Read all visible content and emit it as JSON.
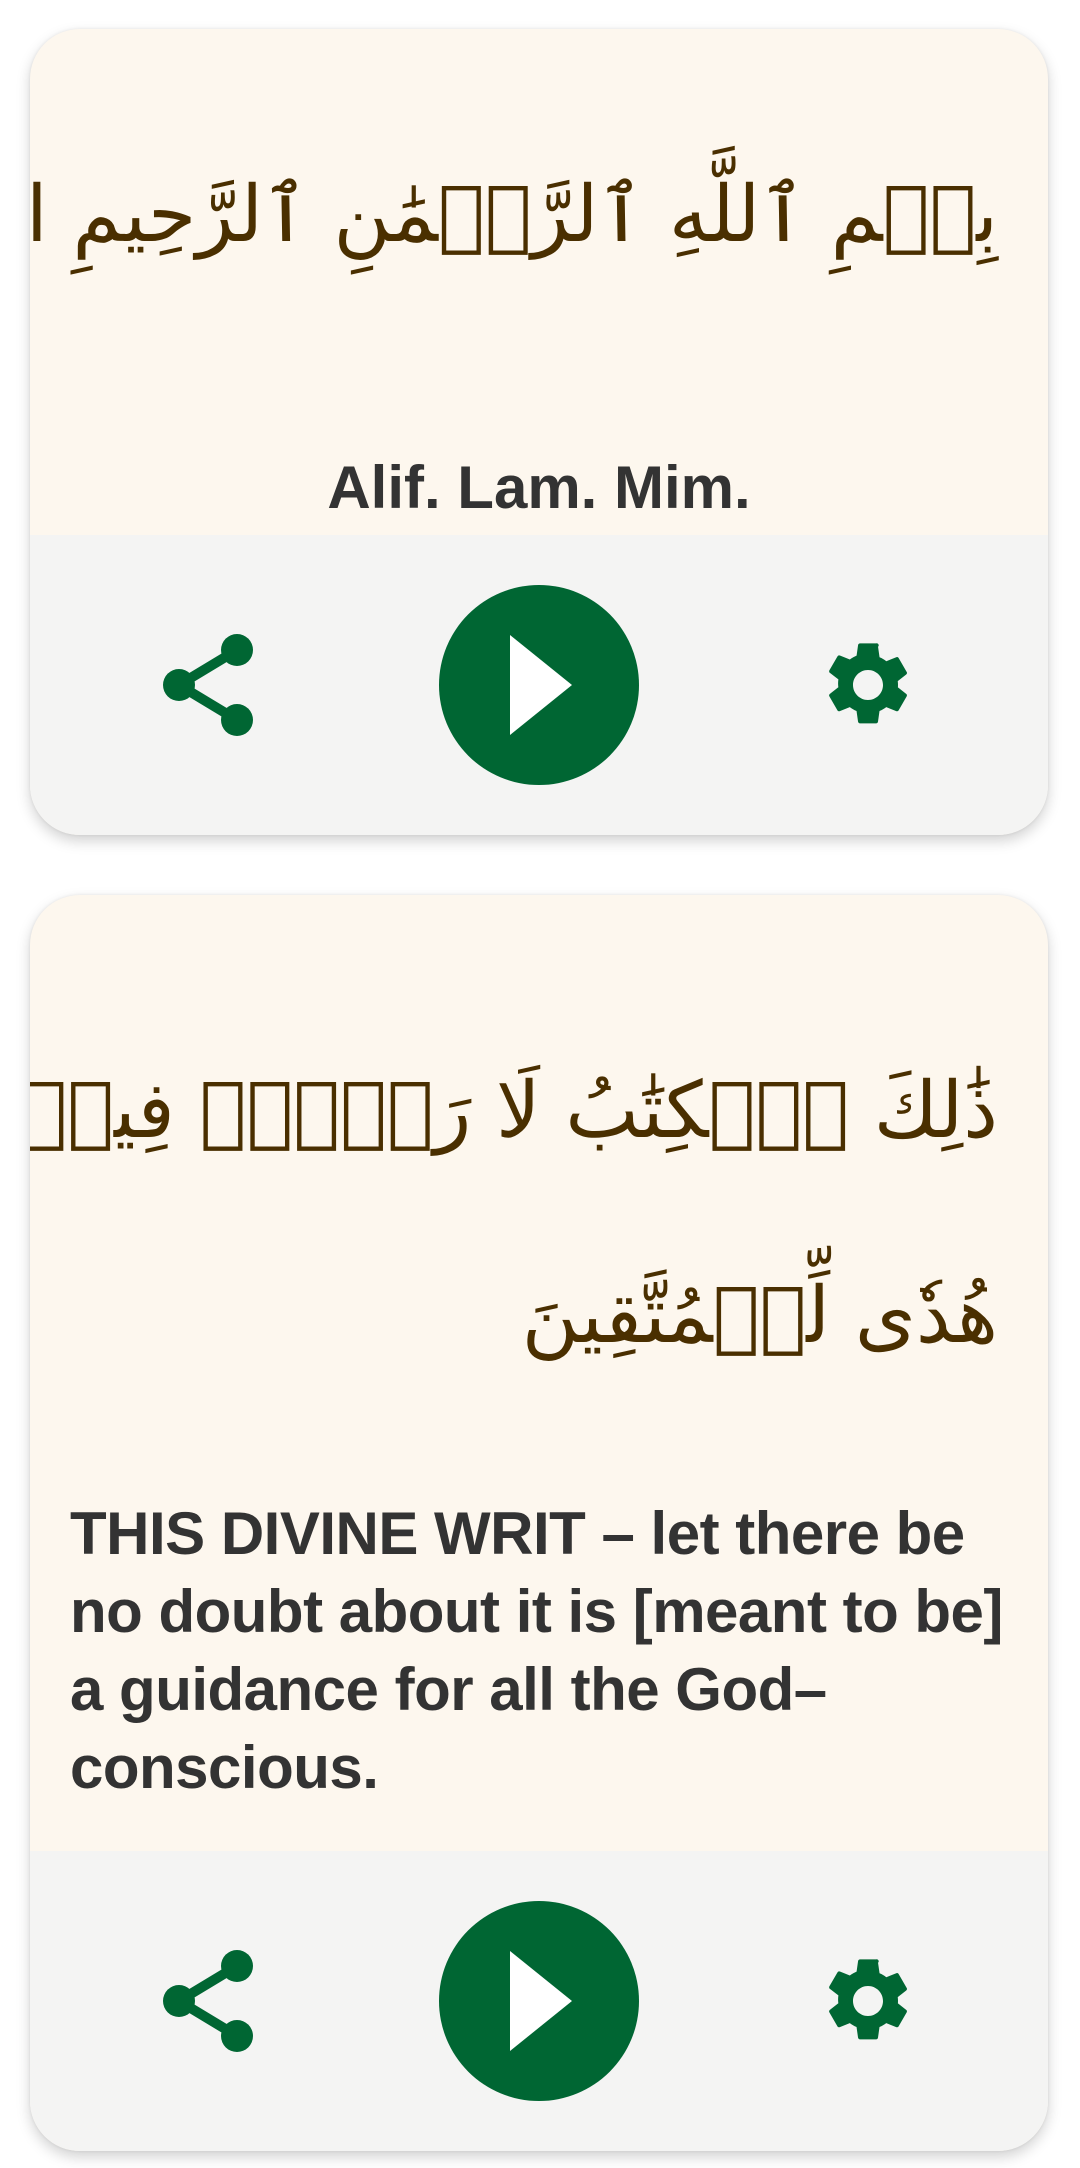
{
  "colors": {
    "card_background": "#fdf7ee",
    "controls_background": "#f4f4f3",
    "accent_green": "#006633",
    "arabic_text": "#4a2f00",
    "translation_text": "#333333"
  },
  "ayahs": [
    {
      "arabic_lines": [
        "بِسۡمِ ٱللَّهِ ٱلرَّحۡمَٰنِ ٱلرَّحِيمِ الٓمٓ"
      ],
      "translation": "Alif. Lam. Mim.",
      "controls": {
        "share_icon": "share-icon",
        "play_icon": "play-icon",
        "settings_icon": "gear-icon"
      }
    },
    {
      "arabic_lines": [
        "ذَٰلِكَ ٱلۡكِتَٰبُ لَا رَيۡبَۛ فِيهِۛ",
        "هُدٗى لِّلۡمُتَّقِينَ"
      ],
      "translation": "THIS DIVINE WRIT – let there be no doubt about it is [meant to be] a guidance for all the God–conscious.",
      "controls": {
        "share_icon": "share-icon",
        "play_icon": "play-icon",
        "settings_icon": "gear-icon"
      }
    }
  ]
}
